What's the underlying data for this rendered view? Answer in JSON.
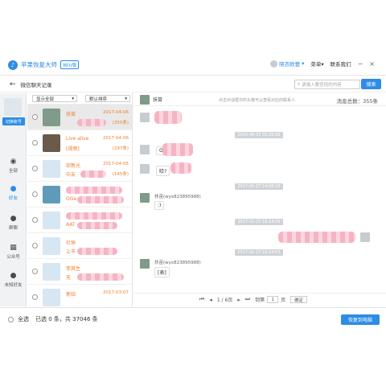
{
  "app": {
    "logo_glyph": "♪",
    "name": "苹果恢复大师",
    "badge": "Win版",
    "user": "晓衣欧壹",
    "menu": "菜单",
    "contact": "联系我们",
    "minimize": "−",
    "close": "×"
  },
  "sub": {
    "back": "←",
    "title": "微信聊天记录",
    "search_placeholder": "请输入要查找的内容",
    "search_btn": "搜索"
  },
  "nav": {
    "switch": "切换账号",
    "items": [
      {
        "label": "全部",
        "icon": "grid-icon"
      },
      {
        "label": "好友",
        "icon": "user-icon"
      },
      {
        "label": "群聊",
        "icon": "group-icon"
      },
      {
        "label": "公众号",
        "icon": "apps-icon"
      },
      {
        "label": "未知好友",
        "icon": "unknown-user-icon"
      }
    ]
  },
  "list": {
    "filter": "显示全部",
    "sort": "默认排序",
    "rows": [
      {
        "name": "扶苗",
        "date": "2017-04-06",
        "count": "(355条)"
      },
      {
        "name": "Live alive",
        "sub": "[视频]",
        "date": "2017-04-06",
        "count": "(297条)"
      },
      {
        "name": "邱新光",
        "sub": "中友",
        "date": "2017-04-05",
        "count": "(145条)"
      },
      {
        "name": "",
        "sub": "OGe",
        "date": "",
        "count": ""
      },
      {
        "name": "",
        "sub": "AAT",
        "date": "",
        "count": ""
      },
      {
        "name": "社恒",
        "sub": "上市",
        "date": "",
        "count": ""
      },
      {
        "name": "菲其生",
        "sub": "无",
        "date": "",
        "count": ""
      },
      {
        "name": "郭绍",
        "sub": "",
        "date": "2017-03-07",
        "count": ""
      }
    ]
  },
  "chat": {
    "name": "扶苗",
    "hint": "点击对话框中的头像可以查看对应的联系人",
    "total": "消息总数：355条",
    "ts": [
      "2016-08-01 01:26:56",
      "2017-01-27 14:05:20",
      "2017-01-27 16:14:09",
      "2017-01-27 16:24:53"
    ],
    "msgs": [
      {
        "text": "ʘ"
      },
      {
        "text": "哈?"
      },
      {
        "sender": "扶苗(wyx823895988)",
        "text": ":)"
      },
      {
        "sender": "扶苗(wyx823895988)",
        "text": "[表]"
      }
    ],
    "pager": {
      "page": "1 / 6页",
      "goto": "到第",
      "page_no": "1",
      "unit": "页",
      "ok": "确定"
    }
  },
  "bottom": {
    "select_all": "全选",
    "status": "已选 0 条，共 37046 条",
    "recover": "恢复到电脑"
  }
}
